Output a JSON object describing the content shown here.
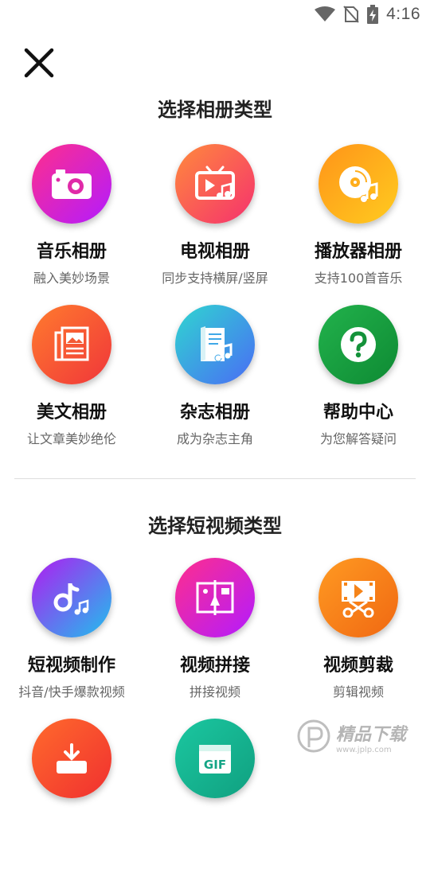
{
  "status_bar": {
    "time": "4:16",
    "icons": [
      "wifi-icon",
      "no-sim-icon",
      "battery-charging-icon"
    ]
  },
  "header": {
    "close_icon": "close-icon"
  },
  "album_section": {
    "title": "选择相册类型",
    "items": [
      {
        "title": "音乐相册",
        "subtitle": "融入美妙场景",
        "icon": "camera-icon",
        "gradient": [
          "#ff2e8c",
          "#b31bff"
        ]
      },
      {
        "title": "电视相册",
        "subtitle": "同步支持横屏/竖屏",
        "icon": "tv-music-icon",
        "gradient": [
          "#ff7a3c",
          "#f5316e"
        ]
      },
      {
        "title": "播放器相册",
        "subtitle": "支持100首音乐",
        "icon": "music-disc-icon",
        "gradient": [
          "#ff9d1c",
          "#ffc21a"
        ]
      },
      {
        "title": "美文相册",
        "subtitle": "让文章美妙绝伦",
        "icon": "article-icon",
        "gradient": [
          "#ff7b2e",
          "#f0363a"
        ]
      },
      {
        "title": "杂志相册",
        "subtitle": "成为杂志主角",
        "icon": "magazine-icon",
        "gradient": [
          "#2fd6d0",
          "#4a6cf5"
        ]
      },
      {
        "title": "帮助中心",
        "subtitle": "为您解答疑问",
        "icon": "help-icon",
        "gradient": [
          "#1aaa43",
          "#0f8c35"
        ]
      }
    ]
  },
  "video_section": {
    "title": "选择短视频类型",
    "items": [
      {
        "title": "短视频制作",
        "subtitle": "抖音/快手爆款视频",
        "icon": "tiktok-note-icon",
        "gradient": [
          "#a020f0",
          "#22b8f0"
        ]
      },
      {
        "title": "视频拼接",
        "subtitle": "拼接视频",
        "icon": "video-stitch-icon",
        "gradient": [
          "#ff2e8c",
          "#b31bff"
        ]
      },
      {
        "title": "视频剪裁",
        "subtitle": "剪辑视频",
        "icon": "video-cut-icon",
        "gradient": [
          "#ff9420",
          "#f26b10"
        ]
      },
      {
        "title": "",
        "subtitle": "",
        "icon": "download-icon",
        "gradient": [
          "#ff6a2c",
          "#f03030"
        ]
      },
      {
        "title": "",
        "subtitle": "",
        "icon": "gif-icon",
        "gradient": [
          "#1bc7a0",
          "#10a080"
        ]
      }
    ]
  },
  "watermark": {
    "text": "精品下载",
    "url": "www.jplp.com"
  }
}
